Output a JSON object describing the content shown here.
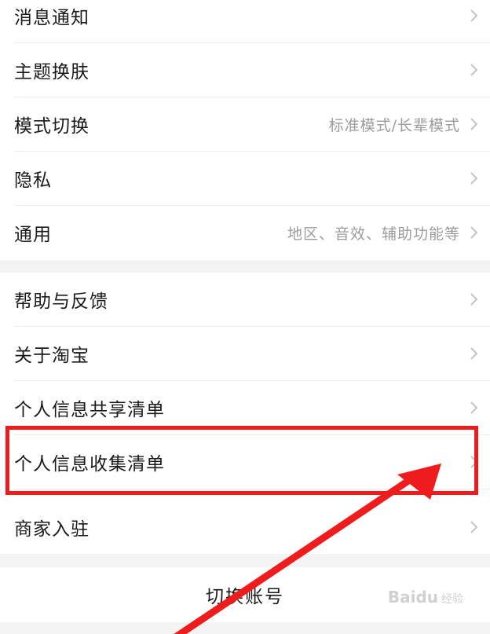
{
  "settings": {
    "group1": [
      {
        "label": "消息通知",
        "sub": ""
      },
      {
        "label": "主题换肤",
        "sub": ""
      },
      {
        "label": "模式切换",
        "sub": "标准模式/长辈模式"
      },
      {
        "label": "隐私",
        "sub": ""
      },
      {
        "label": "通用",
        "sub": "地区、音效、辅助功能等"
      }
    ],
    "group2": [
      {
        "label": "帮助与反馈",
        "sub": ""
      },
      {
        "label": "关于淘宝",
        "sub": ""
      },
      {
        "label": "个人信息共享清单",
        "sub": ""
      },
      {
        "label": "个人信息收集清单",
        "sub": ""
      },
      {
        "label": "商家入驻",
        "sub": ""
      }
    ],
    "switch_account": "切换账号"
  },
  "watermark": {
    "brand": "Baidu",
    "sub": "经验"
  },
  "colors": {
    "annotation": "#ee1c1c",
    "chevron": "#c4c4c4",
    "secondary_text": "#9c9c9c"
  },
  "icons": {
    "row_arrow": "chevron-right-icon"
  }
}
